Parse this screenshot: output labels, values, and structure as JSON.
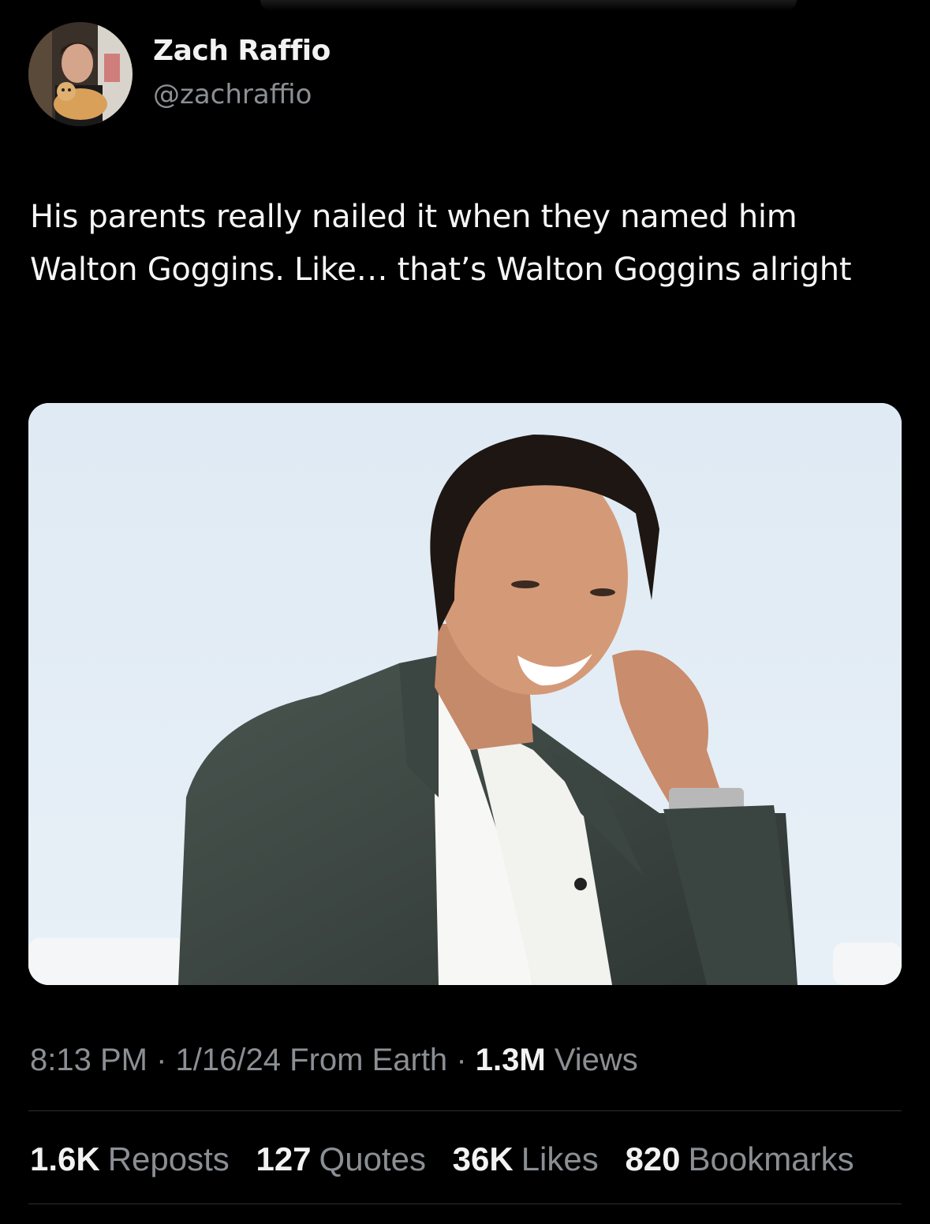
{
  "tweet": {
    "author": {
      "display_name": "Zach Raffio",
      "handle": "@zachraffio"
    },
    "text": "His parents really nailed it when they named him Walton Goggins. Like… that’s Walton Goggins alright",
    "meta": {
      "time": "8:13 PM",
      "date": "1/16/24",
      "location": "From Earth",
      "views_count": "1.3M",
      "views_label": "Views",
      "separator": "·"
    },
    "stats": [
      {
        "count": "1.6K",
        "label": "Reposts"
      },
      {
        "count": "127",
        "label": "Quotes"
      },
      {
        "count": "36K",
        "label": "Likes"
      },
      {
        "count": "820",
        "label": "Bookmarks"
      }
    ]
  },
  "colors": {
    "background": "#000000",
    "primary_text": "#e7e9ea",
    "secondary_text": "#8b8f94",
    "divider": "#2a2d30"
  }
}
